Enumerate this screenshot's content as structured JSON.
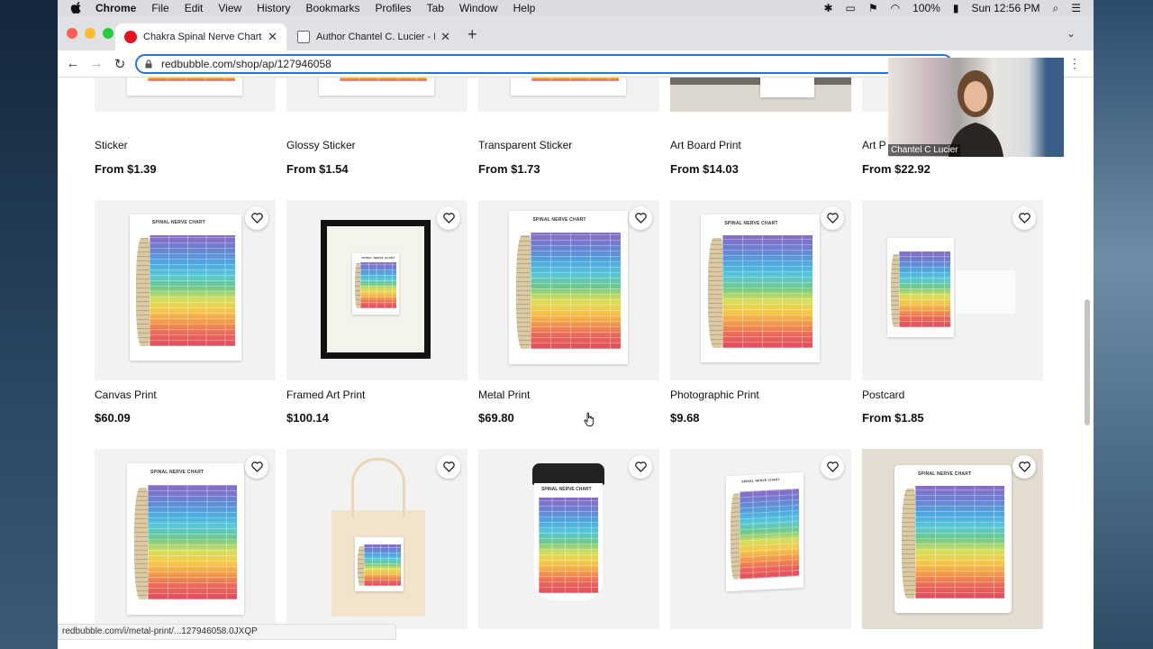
{
  "menubar": {
    "app": "Chrome",
    "menus": [
      "File",
      "Edit",
      "View",
      "History",
      "Bookmarks",
      "Profiles",
      "Tab",
      "Window",
      "Help"
    ],
    "battery": "100%",
    "clock": "Sun 12:56 PM"
  },
  "browser": {
    "tabs": [
      {
        "title": "Chakra Spinal Nerve Chart by",
        "favicon_color": "#e41321"
      },
      {
        "title": "Author Chantel C. Lucier - Boo",
        "favicon_color": "#666666"
      }
    ],
    "url": "redbubble.com/shop/ap/127946058",
    "status_url": "redbubble.com/i/metal-print/...127946058.0JXQP"
  },
  "products": {
    "row1": [
      {
        "name": "Sticker",
        "price": "From $1.39"
      },
      {
        "name": "Glossy Sticker",
        "price": "From $1.54"
      },
      {
        "name": "Transparent Sticker",
        "price": "From $1.73"
      },
      {
        "name": "Art Board Print",
        "price": "From $14.03"
      },
      {
        "name": "Art P",
        "price": "From $22.92"
      }
    ],
    "row2": [
      {
        "name": "Canvas Print",
        "price": "$60.09",
        "chart_title": "SPINAL NERVE CHART"
      },
      {
        "name": "Framed Art Print",
        "price": "$100.14",
        "chart_title": "SPINAL NERVE CHART"
      },
      {
        "name": "Metal Print",
        "price": "$69.80",
        "chart_title": "SPINAL NERVE CHART"
      },
      {
        "name": "Photographic Print",
        "price": "$9.68",
        "chart_title": "SPINAL NERVE CHART"
      },
      {
        "name": "Postcard",
        "price": "From $1.85",
        "chart_title": ""
      }
    ],
    "row3_titles": [
      "SPINAL NERVE CHART",
      "",
      "SPINAL NERVE CHART",
      "SPINAL NERVE CHART",
      "SPINAL NERVE CHART"
    ]
  },
  "webcam": {
    "name": "Chantel C Lucier"
  },
  "colors": {
    "accent": "#2a73d9",
    "redbubble": "#e41321"
  }
}
